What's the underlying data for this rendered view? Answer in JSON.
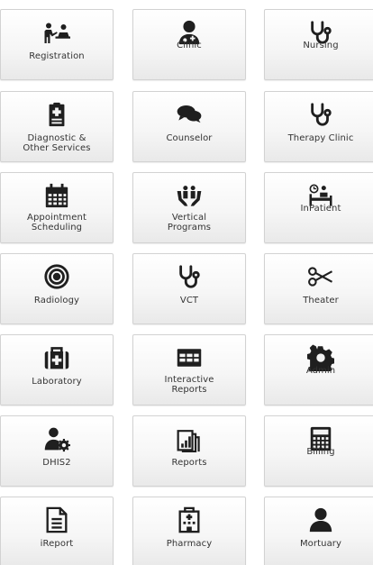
{
  "tiles": [
    {
      "label": "Registration",
      "icon": "registration-icon"
    },
    {
      "label": "Clinic",
      "icon": "doctor-icon"
    },
    {
      "label": "Nursing",
      "icon": "stethoscope-icon"
    },
    {
      "label": "Diagnostic &\nOther Services",
      "icon": "clipboard-icon"
    },
    {
      "label": "Counselor",
      "icon": "chat-bubbles-icon"
    },
    {
      "label": "Therapy Clinic",
      "icon": "stethoscope-icon"
    },
    {
      "label": "Appointment\nScheduling",
      "icon": "calendar-icon"
    },
    {
      "label": "Vertical\nPrograms",
      "icon": "hands-people-icon"
    },
    {
      "label": "InPatient",
      "icon": "hospital-bed-icon"
    },
    {
      "label": "Radiology",
      "icon": "target-icon"
    },
    {
      "label": "VCT",
      "icon": "stethoscope-icon"
    },
    {
      "label": "Theater",
      "icon": "scissors-icon"
    },
    {
      "label": "Laboratory",
      "icon": "medkit-icon"
    },
    {
      "label": "Interactive\nReports",
      "icon": "table-icon"
    },
    {
      "label": "Admin",
      "icon": "gear-icon"
    },
    {
      "label": "DHIS2",
      "icon": "user-gear-icon"
    },
    {
      "label": "Reports",
      "icon": "chart-report-icon"
    },
    {
      "label": "Billing",
      "icon": "calculator-icon"
    },
    {
      "label": "iReport",
      "icon": "document-icon"
    },
    {
      "label": "Pharmacy",
      "icon": "building-icon"
    },
    {
      "label": "Mortuary",
      "icon": "person-icon"
    }
  ],
  "colors": {
    "icon": "#1f1f1f",
    "text": "#333333",
    "tile_border": "#d2d2d2"
  }
}
